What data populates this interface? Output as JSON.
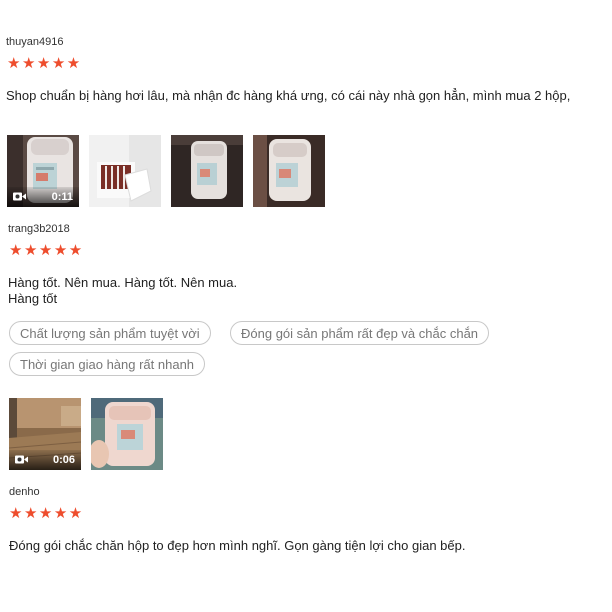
{
  "reviews": [
    {
      "username": "thuyan4916",
      "stars": "★★★★★",
      "text": "Shop chuẩn bị hàng hơi lâu, mà nhận đc hàng khá ưng, có cái này nhà gọn hẳn, mình mua 2 hộp,",
      "video_duration": "0:11"
    },
    {
      "username": "trang3b2018",
      "stars": "★★★★★",
      "text_line1": "Hàng tốt. Nên mua. Hàng tốt. Nên mua.",
      "text_line2": "Hàng tốt",
      "tags": [
        "Chất lượng sản phẩm tuyệt vời",
        "Đóng gói sản phẩm rất đẹp và chắc chắn",
        "Thời gian giao hàng rất nhanh"
      ],
      "video_duration": "0:06"
    },
    {
      "username": "denho",
      "stars": "★★★★★",
      "text": "Đóng gói chắc chăn hộp to đẹp hơn mình nghĩ. Gọn gàng tiện lợi cho gian bếp."
    }
  ],
  "colors": {
    "star": "#ee4d2d",
    "tag_border": "#c8c8c8",
    "tag_text": "#777777"
  },
  "icons": {
    "video": "video-camera-icon",
    "star": "star-icon"
  }
}
